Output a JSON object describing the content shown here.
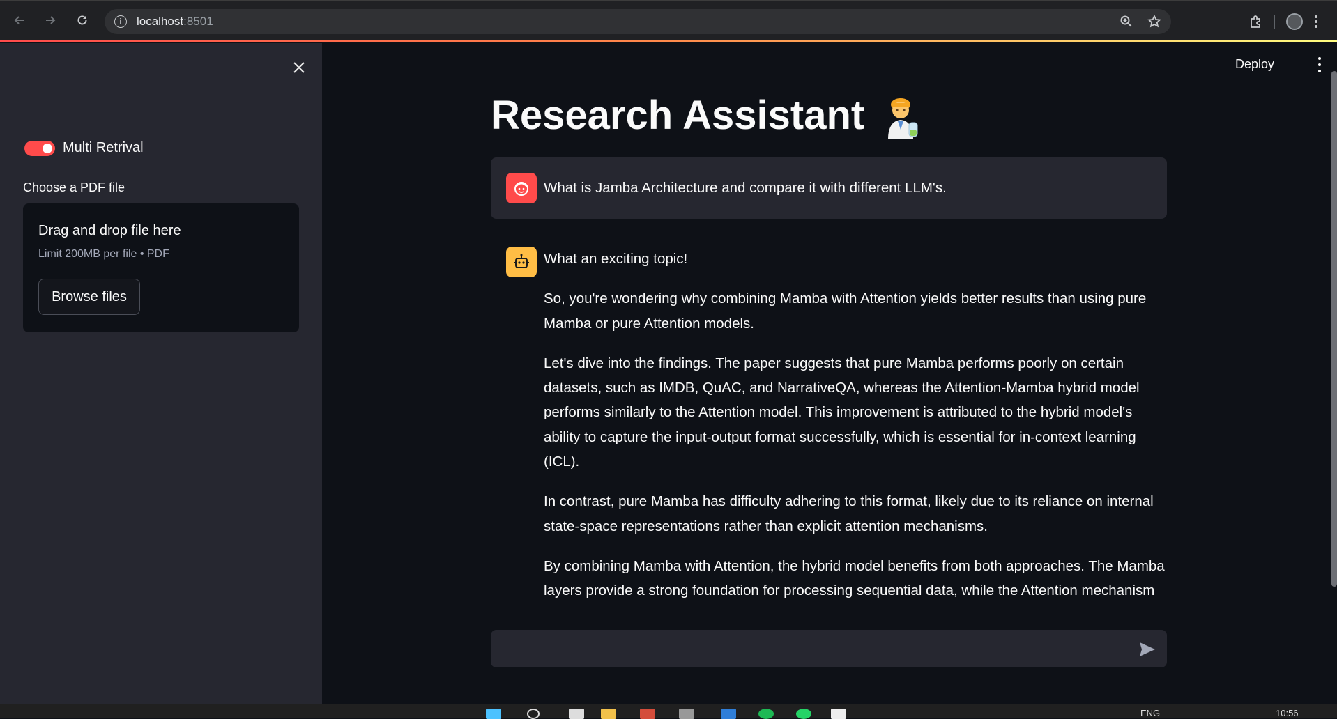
{
  "browser": {
    "url_host": "localhost",
    "url_port": ":8501"
  },
  "sidebar": {
    "toggle_label": "Multi Retrival",
    "toggle_on": true,
    "file_label": "Choose a PDF file",
    "dropzone_title": "Drag and drop file here",
    "dropzone_limit": "Limit 200MB per file • PDF",
    "browse_label": "Browse files"
  },
  "header": {
    "deploy_label": "Deploy"
  },
  "main": {
    "title": "Research Assistant",
    "user_message": "What is Jamba Architecture and compare it with different LLM's.",
    "assistant_paragraphs": [
      "What an exciting topic!",
      "So, you're wondering why combining Mamba with Attention yields better results than using pure Mamba or pure Attention models.",
      "Let's dive into the findings. The paper suggests that pure Mamba performs poorly on certain datasets, such as IMDB, QuAC, and NarrativeQA, whereas the Attention-Mamba hybrid model performs similarly to the Attention model. This improvement is attributed to the hybrid model's ability to capture the input-output format successfully, which is essential for in-context learning (ICL).",
      "In contrast, pure Mamba has difficulty adhering to this format, likely due to its reliance on internal state-space representations rather than explicit attention mechanisms.",
      "By combining Mamba with Attention, the hybrid model benefits from both approaches. The Mamba layers provide a strong foundation for processing sequential data, while the Attention mechanism allows the model to focus on relevant parts of the input sequence and capture"
    ],
    "chat_input_value": ""
  },
  "taskbar": {
    "lang": "ENG",
    "time": "10:56"
  },
  "colors": {
    "accent": "#ff4b4b",
    "bot_avatar": "#ffbd45",
    "background": "#0e1117",
    "sidebar": "#262730"
  }
}
